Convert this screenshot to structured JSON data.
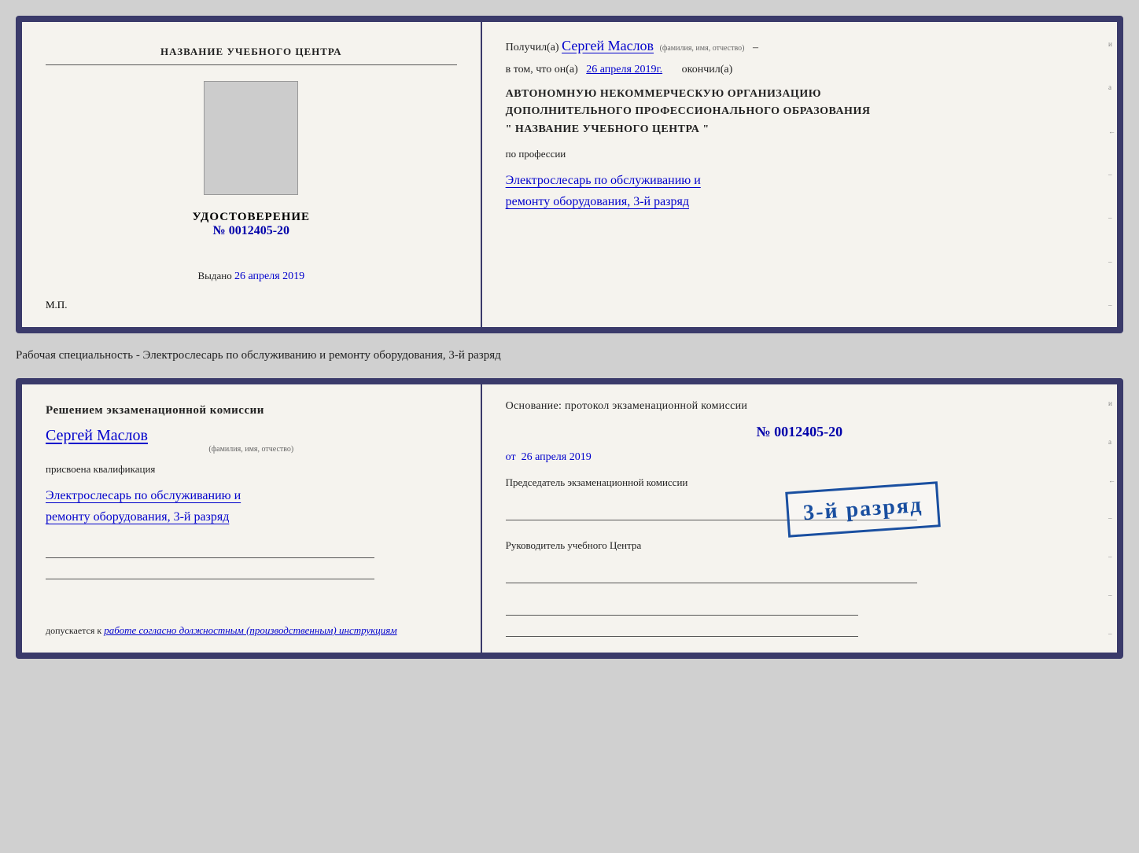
{
  "top_card": {
    "left": {
      "center_title": "НАЗВАНИЕ УЧЕБНОГО ЦЕНТРА",
      "cert_label": "УДОСТОВЕРЕНИЕ",
      "cert_number_prefix": "№",
      "cert_number": "0012405-20",
      "issued_label": "Выдано",
      "issued_date": "26 апреля 2019",
      "mp_label": "М.П."
    },
    "right": {
      "received_prefix": "Получил(а)",
      "recipient_name": "Сергей Маслов",
      "name_subtitle": "(фамилия, имя, отчество)",
      "in_that_prefix": "в том, что он(а)",
      "completion_date": "26 апреля 2019г.",
      "finished_label": "окончил(а)",
      "org_line1": "АВТОНОМНУЮ НЕКОММЕРЧЕСКУЮ ОРГАНИЗАЦИЮ",
      "org_line2": "ДОПОЛНИТЕЛЬНОГО ПРОФЕССИОНАЛЬНОГО ОБРАЗОВАНИЯ",
      "org_line3": "\"   НАЗВАНИЕ УЧЕБНОГО ЦЕНТРА   \"",
      "profession_label": "по профессии",
      "profession_text": "Электрослесарь по обслуживанию и",
      "profession_text2": "ремонту оборудования, 3-й разряд"
    }
  },
  "middle_label": "Рабочая специальность - Электрослесарь по обслуживанию и ремонту оборудования, 3-й разряд",
  "bottom_card": {
    "left": {
      "decision_title": "Решением экзаменационной  комиссии",
      "person_name": "Сергей Маслов",
      "fio_subtitle": "(фамилия, имя, отчество)",
      "assigned_label": "присвоена квалификация",
      "qualification_line1": "Электрослесарь по обслуживанию и",
      "qualification_line2": "ремонту оборудования, 3-й разряд",
      "allowed_label": "допускается к",
      "allowed_text": "работе согласно должностным (производственным) инструкциям"
    },
    "right": {
      "basis_title": "Основание: протокол экзаменационной  комиссии",
      "number_prefix": "№",
      "protocol_number": "0012405-20",
      "date_prefix": "от",
      "protocol_date": "26 апреля 2019",
      "chairman_title": "Председатель экзаменационной комиссии",
      "manager_title": "Руководитель учебного Центра"
    },
    "stamp_text": "3-й разряд"
  },
  "right_edge": {
    "marks": [
      "и",
      "а",
      "←",
      "–",
      "–",
      "–",
      "–"
    ]
  }
}
